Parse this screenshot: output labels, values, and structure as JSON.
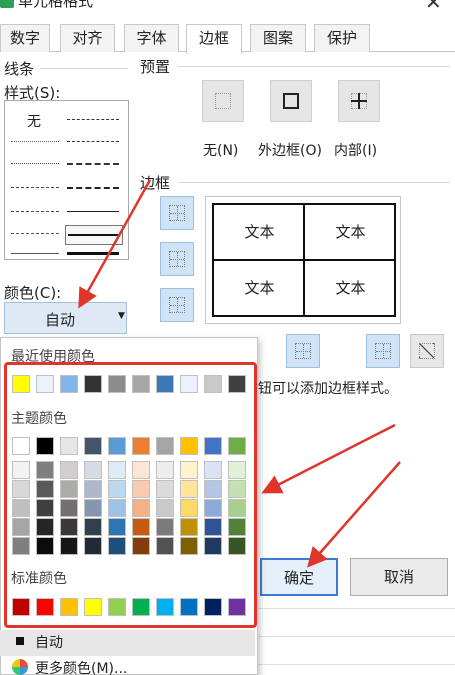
{
  "window": {
    "title": "单元格格式",
    "close_glyph": "✕"
  },
  "tabs": [
    {
      "label": "数字",
      "active": false
    },
    {
      "label": "对齐",
      "active": false
    },
    {
      "label": "字体",
      "active": false
    },
    {
      "label": "边框",
      "active": true
    },
    {
      "label": "图案",
      "active": false
    },
    {
      "label": "保护",
      "active": false
    }
  ],
  "line": {
    "section_label": "线条",
    "style_label": "样式(S):",
    "none_label": "无",
    "color_label": "颜色(C):",
    "color_value": "自动"
  },
  "presets": {
    "section_label": "预置",
    "items": [
      {
        "label": "无(N)",
        "icon": "border-none-icon"
      },
      {
        "label": "外边框(O)",
        "icon": "border-outline-icon"
      },
      {
        "label": "内部(I)",
        "icon": "border-inside-icon"
      }
    ]
  },
  "border": {
    "section_label": "边框",
    "preview_cells": [
      "文本",
      "文本",
      "文本",
      "文本"
    ]
  },
  "hint": "钮可以添加边框样式。",
  "buttons": {
    "ok": "确定",
    "cancel": "取消"
  },
  "color_popup": {
    "recent_label": "最近使用颜色",
    "recent_colors": [
      "#ffff00",
      "#eaf1fb",
      "#7fb7e8",
      "#333333",
      "#8c8c8c",
      "#a6a6a6",
      "#3b78b8",
      "#eaf1fb",
      "#c8c8c8",
      "#404040"
    ],
    "theme_label": "主题颜色",
    "theme_top": [
      "#ffffff",
      "#000000",
      "#e7e6e6",
      "#44546a",
      "#5b9bd5",
      "#ed7d31",
      "#a5a5a5",
      "#ffc000",
      "#4472c4",
      "#70ad47"
    ],
    "theme_shades": [
      [
        "#f2f2f2",
        "#7f7f7f",
        "#d0cece",
        "#d6dce4",
        "#deebf6",
        "#fbe5d5",
        "#ededed",
        "#fff2cc",
        "#dae3f3",
        "#e2efd9"
      ],
      [
        "#d8d8d8",
        "#595959",
        "#aeabab",
        "#adb9ca",
        "#bdd7ee",
        "#f8cbad",
        "#dbdbdb",
        "#fee599",
        "#b4c6e7",
        "#c5e0b3"
      ],
      [
        "#bfbfbf",
        "#3f3f3f",
        "#757070",
        "#8496b0",
        "#9cc3e5",
        "#f4b183",
        "#c9c9c9",
        "#ffd965",
        "#8eaadb",
        "#a8d08d"
      ],
      [
        "#a5a5a5",
        "#262626",
        "#3a3838",
        "#323f4f",
        "#2e75b5",
        "#c55a11",
        "#7b7b7b",
        "#bf9000",
        "#2f5496",
        "#538135"
      ],
      [
        "#7f7f7f",
        "#0c0c0c",
        "#171616",
        "#222a35",
        "#1e4e79",
        "#833c0b",
        "#525252",
        "#7f6000",
        "#1f3864",
        "#375623"
      ]
    ],
    "standard_label": "标准颜色",
    "standard_colors": [
      "#c00000",
      "#ff0000",
      "#ffc000",
      "#ffff00",
      "#92d050",
      "#00b050",
      "#00b0f0",
      "#0070c0",
      "#002060",
      "#7030a0"
    ],
    "auto_label": "自动",
    "more_label": "更多颜色(M)..."
  },
  "annotation_color": "#e0352b"
}
